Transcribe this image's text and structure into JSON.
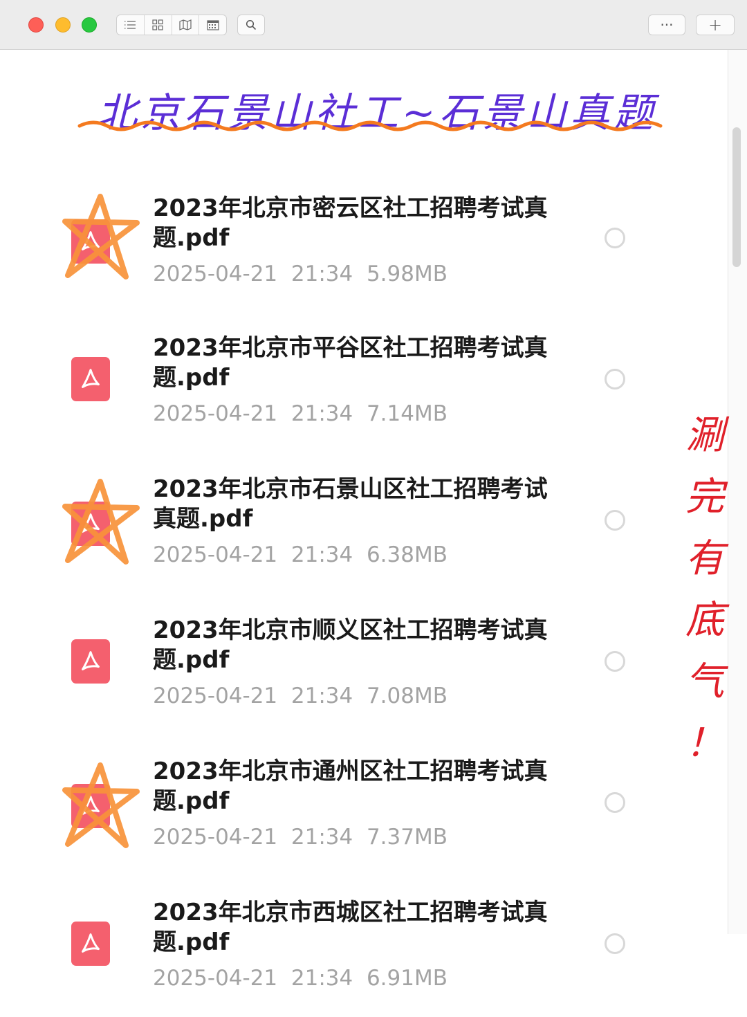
{
  "toolbar": {
    "view_icons": [
      "list-view-icon",
      "grid-view-icon",
      "map-view-icon",
      "calendar-view-icon"
    ],
    "search_icon": "search-icon",
    "more_label": "···",
    "add_label": "+"
  },
  "headline": {
    "text": "北京石景山社工~石景山真题",
    "color": "#5b2ed6",
    "underline_color": "#f47a1f"
  },
  "side_note": {
    "chars": [
      "涮",
      "完",
      "有",
      "底",
      "气",
      "！"
    ],
    "color": "#e0202a"
  },
  "files": [
    {
      "name": "2023年北京市密云区社工招聘考试真题.pdf",
      "date": "2025-04-21",
      "time": "21:34",
      "size": "5.98MB",
      "starred": true
    },
    {
      "name": "2023年北京市平谷区社工招聘考试真题.pdf",
      "date": "2025-04-21",
      "time": "21:34",
      "size": "7.14MB",
      "starred": false
    },
    {
      "name": "2023年北京市石景山区社工招聘考试真题.pdf",
      "date": "2025-04-21",
      "time": "21:34",
      "size": "6.38MB",
      "starred": true
    },
    {
      "name": "2023年北京市顺义区社工招聘考试真题.pdf",
      "date": "2025-04-21",
      "time": "21:34",
      "size": "7.08MB",
      "starred": false
    },
    {
      "name": "2023年北京市通州区社工招聘考试真题.pdf",
      "date": "2025-04-21",
      "time": "21:34",
      "size": "7.37MB",
      "starred": true
    },
    {
      "name": "2023年北京市西城区社工招聘考试真题.pdf",
      "date": "2025-04-21",
      "time": "21:34",
      "size": "6.91MB",
      "starred": false
    }
  ],
  "colors": {
    "pdf_icon": "#f4606e",
    "star": "#f7923a"
  }
}
